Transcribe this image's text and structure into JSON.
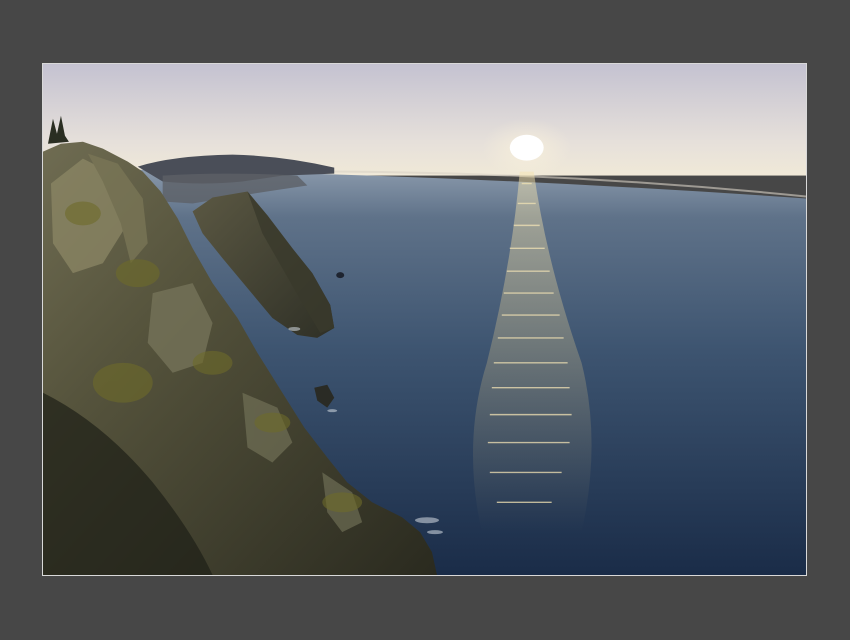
{
  "scene": {
    "subject": "coastal-cliffs-at-sunset",
    "colors": {
      "page_background": "#474747",
      "frame_border": "#d9d9d9",
      "sky_top": "#c9c6d2",
      "sky_horizon": "#efe8d6",
      "sea_near_horizon": "#7e8ea2",
      "sea_mid": "#3f5673",
      "sea_deep": "#1c2f4b",
      "cliff_shadow": "#2a2b22",
      "cliff_lit": "#8a8462",
      "moss": "#6a6a2e",
      "sun": "#ffffff",
      "sun_glitter": "#e8d7a2"
    }
  }
}
